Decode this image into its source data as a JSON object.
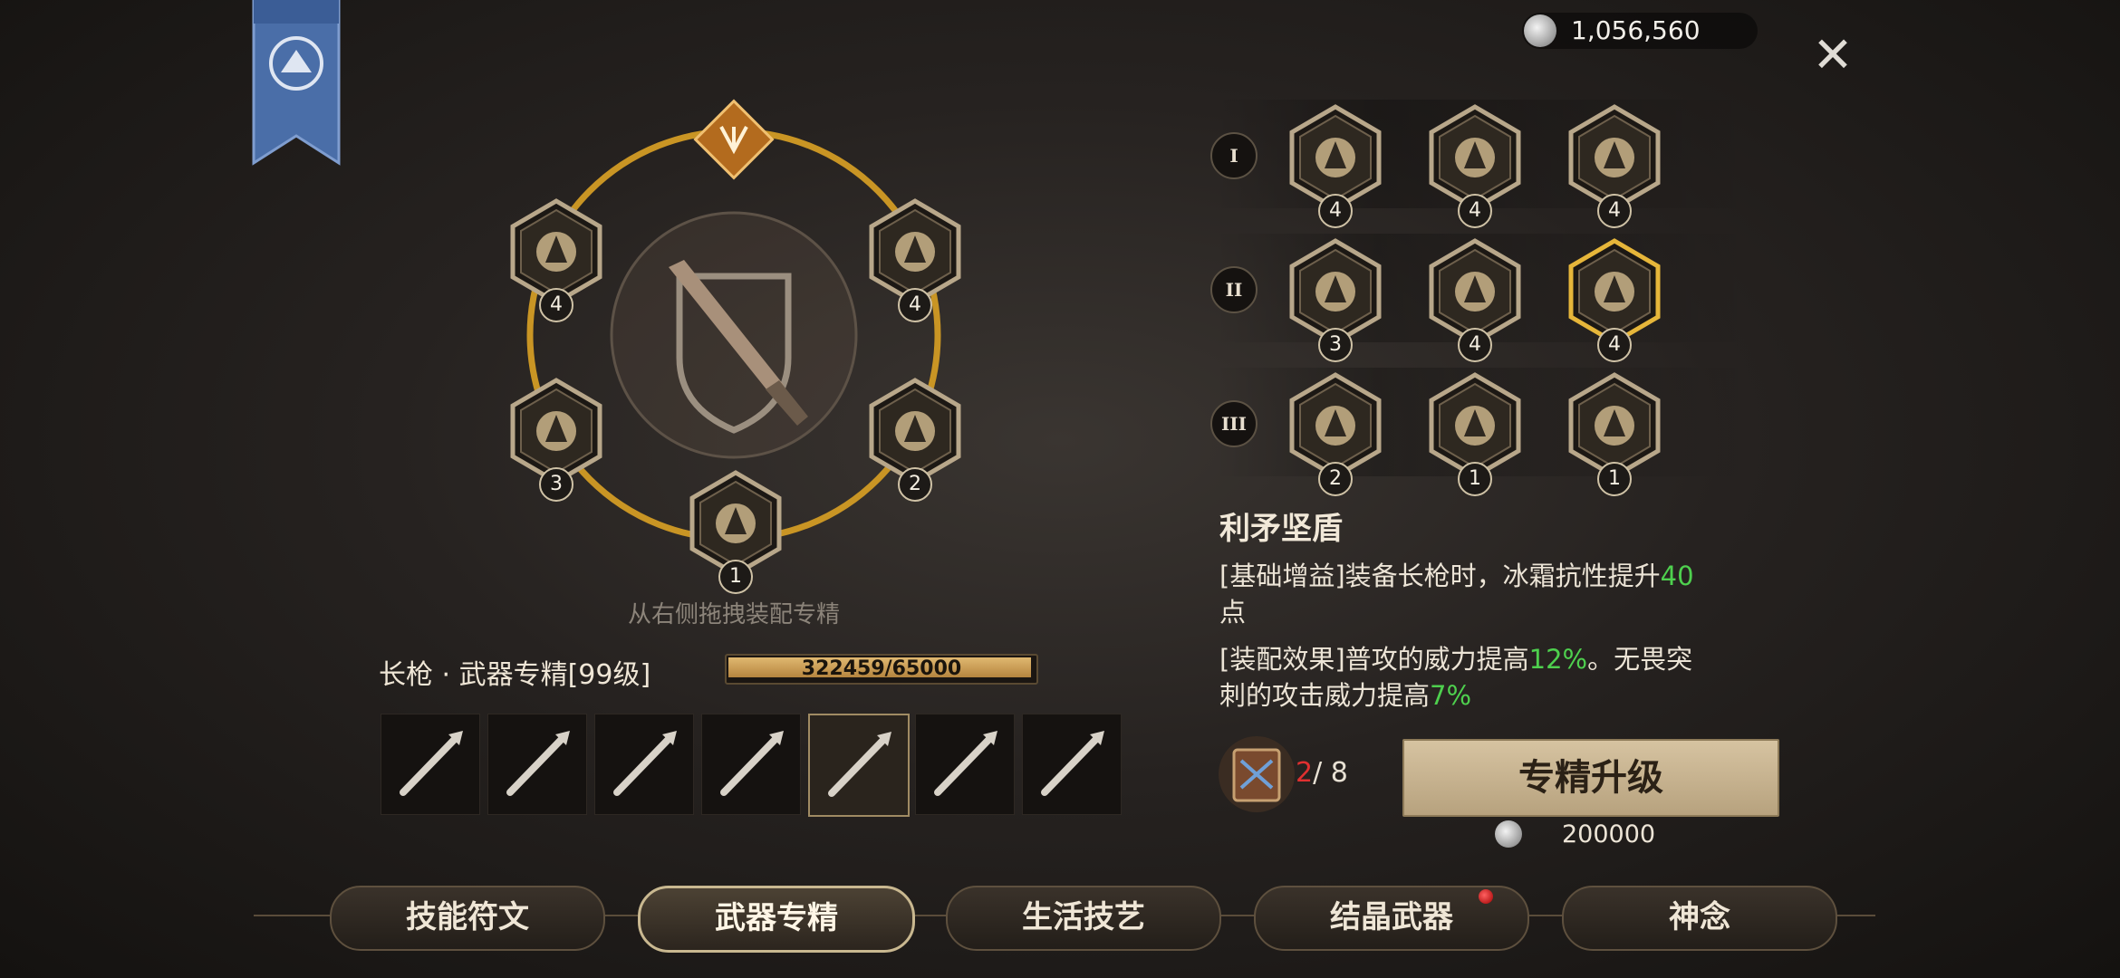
{
  "currency": {
    "value": "1,056,560",
    "icon": "silver-coin-icon"
  },
  "close_icon": "✕",
  "ring": {
    "center_icon": "spear-shield-icon",
    "slots": [
      {
        "icon": "sword-upgrade-icon",
        "level": "4"
      },
      {
        "icon": "swimmer-icon",
        "level": "4"
      },
      {
        "icon": "fist-shield-icon",
        "level": "3"
      },
      {
        "icon": "flame-helmet-icon",
        "level": "2"
      },
      {
        "icon": "arrow-burst-icon",
        "level": "1"
      }
    ],
    "top_icon": "emblem-icon"
  },
  "hint": "从右侧拖拽装配专精",
  "weapon": {
    "title": "长枪 · 武器专精[99级]",
    "xp_text": "322459/65000",
    "xp_fraction": 1.0
  },
  "weapon_slots": [
    "scythe-icon",
    "rifle-icon",
    "katana-icon",
    "dagger-icon",
    "spear-shield-icon",
    "bow-icon",
    "crossed-swords-icon"
  ],
  "skill_rows": [
    {
      "label": "I",
      "skills": [
        {
          "icon": "swimmer-icon",
          "level": "4"
        },
        {
          "icon": "flexed-arm-icon",
          "level": "4"
        },
        {
          "icon": "sword-figure-icon",
          "level": "4"
        }
      ]
    },
    {
      "label": "II",
      "skills": [
        {
          "icon": "fist-shield-icon",
          "level": "3"
        },
        {
          "icon": "kick-icon",
          "level": "4"
        },
        {
          "icon": "sword-upgrade-icon",
          "level": "4"
        }
      ]
    },
    {
      "label": "III",
      "skills": [
        {
          "icon": "flame-helmet-icon",
          "level": "2"
        },
        {
          "icon": "arrow-burst-icon",
          "level": "1"
        },
        {
          "icon": "potion-icon",
          "level": "1"
        }
      ]
    }
  ],
  "skill": {
    "name": "利矛坚盾",
    "desc1_a": "[基础增益]装备长枪时，冰霜抗性提升",
    "desc1_green": "40",
    "desc1_b": "点",
    "desc2_a": "[装配效果]普攻的威力提高",
    "desc2_green1": "12%",
    "desc2_b": "。无畏突",
    "desc2_c": "刺的攻击威力提高",
    "desc2_green2": "7%"
  },
  "upgrade": {
    "have": "2",
    "need": "/ 8",
    "button": "专精升级",
    "cost": "200000"
  },
  "tabs": [
    "技能符文",
    "武器专精",
    "生活技艺",
    "结晶武器",
    "神念"
  ],
  "colors": {
    "gold": "#d9a133",
    "green": "#4ed04e",
    "red": "#e03030"
  }
}
